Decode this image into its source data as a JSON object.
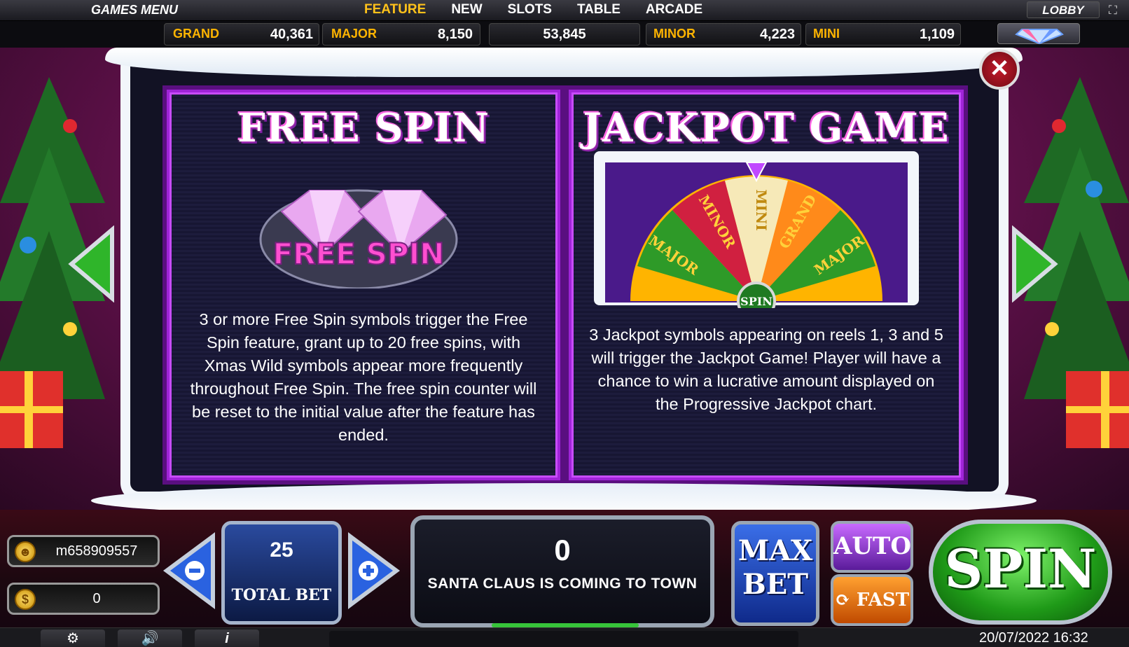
{
  "top_menu": {
    "title": "GAMES MENU",
    "tabs": [
      {
        "label": "FEATURE",
        "active": true
      },
      {
        "label": "NEW",
        "active": false
      },
      {
        "label": "SLOTS",
        "active": false
      },
      {
        "label": "TABLE",
        "active": false
      },
      {
        "label": "ARCADE",
        "active": false
      }
    ],
    "lobby_label": "LOBBY",
    "fullscreen_icon": "fullscreen-icon"
  },
  "jackpots": {
    "grand_label": "GRAND",
    "grand_value": "40,361",
    "major_label": "MAJOR",
    "major_value": "8,150",
    "progressive_value": "53,845",
    "minor_label": "MINOR",
    "minor_value": "4,223",
    "mini_label": "MINI",
    "mini_value": "1,109",
    "diamond_icon": "diamond-icon"
  },
  "info_panels": {
    "free_spin": {
      "title": "FREE SPIN",
      "symbol_text": "FREE SPIN",
      "description": "3 or more Free Spin symbols trigger the Free Spin feature, grant up to 20 free spins, with Xmas Wild symbols appear more frequently throughout Free Spin. The free spin counter will be reset to the initial value after the feature has ended."
    },
    "jackpot_game": {
      "title": "JACKPOT GAME",
      "wheel_segments": [
        "MAJOR",
        "MINOR",
        "MINI",
        "GRAND",
        "MAJOR"
      ],
      "wheel_center": "SPIN",
      "description": "3 Jackpot symbols appearing on reels 1, 3 and 5 will trigger the Jackpot Game! Player will have a chance to win a lucrative amount displayed on the Progressive Jackpot chart."
    }
  },
  "controls": {
    "username": "m658909557",
    "balance": "0",
    "bet_value": "25",
    "total_bet_label": "TOTAL BET",
    "win_value": "0",
    "win_message": "SANTA CLAUS IS COMING TO TOWN",
    "max_bet_line1": "MAX",
    "max_bet_line2": "BET",
    "auto_label": "AUTO",
    "fast_label": "FAST",
    "spin_label": "SPIN"
  },
  "footer": {
    "datetime": "20/07/2022 16:32"
  },
  "colors": {
    "accent_purple": "#a024d8",
    "tab_active": "#ffc21a",
    "jackpot_label": "#ffb400",
    "spin_green": "#1f9a18",
    "max_bet_blue": "#2a5ad8"
  }
}
